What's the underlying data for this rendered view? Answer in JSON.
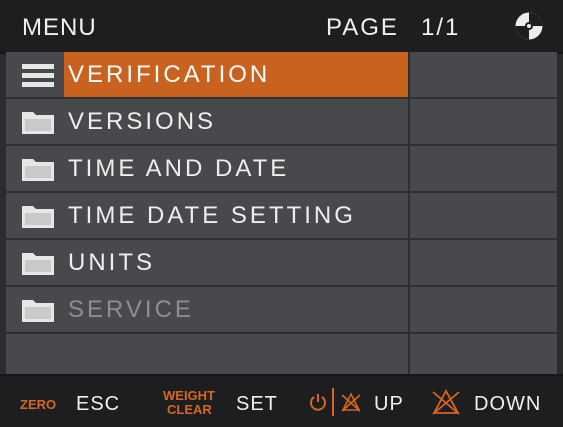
{
  "header": {
    "title": "MENU",
    "page_label": "PAGE",
    "page_number": "1/1"
  },
  "items": [
    {
      "label": "VERIFICATION",
      "icon": "list-icon",
      "state": "selected"
    },
    {
      "label": "VERSIONS",
      "icon": "folder-icon",
      "state": "normal"
    },
    {
      "label": "TIME AND DATE",
      "icon": "folder-icon",
      "state": "normal"
    },
    {
      "label": "TIME DATE SETTING",
      "icon": "folder-icon",
      "state": "normal"
    },
    {
      "label": "UNITS",
      "icon": "folder-icon",
      "state": "normal"
    },
    {
      "label": "SERVICE",
      "icon": "folder-icon",
      "state": "disabled"
    }
  ],
  "footer": {
    "zero_key": "ZERO",
    "esc_label": "ESC",
    "weight_key": "WEIGHT",
    "clear_key": "CLEAR",
    "set_label": "SET",
    "up_label": "UP",
    "down_label": "DOWN"
  },
  "colors": {
    "accent": "#c9621e",
    "header_bg": "#1d1e20",
    "list_bg": "#47494c",
    "disabled_text": "#8c8e91"
  }
}
